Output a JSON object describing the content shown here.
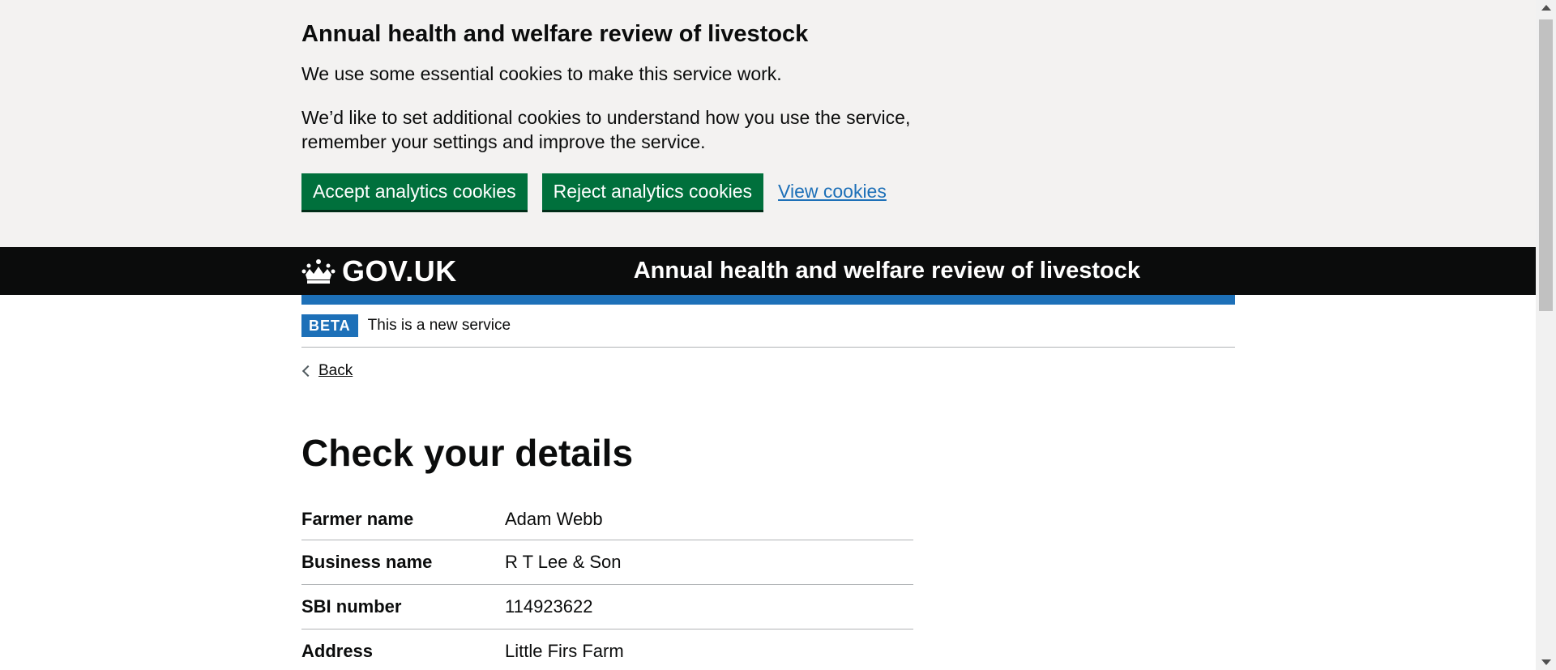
{
  "cookie_banner": {
    "heading": "Annual health and welfare review of livestock",
    "text1": "We use some essential cookies to make this service work.",
    "text2": "We’d like to set additional cookies to understand how you use the service, remember your settings and improve the service.",
    "accept_label": "Accept analytics cookies",
    "reject_label": "Reject analytics cookies",
    "view_label": "View cookies"
  },
  "header": {
    "logo_text": "GOV.UK",
    "logo_icon": "crown-icon",
    "service_name": "Annual health and welfare review of livestock"
  },
  "phase_banner": {
    "tag": "BETA",
    "text": "This is a new service"
  },
  "back_link": "Back",
  "page_title": "Check your details",
  "details": [
    {
      "key": "Farmer name",
      "value": "Adam Webb"
    },
    {
      "key": "Business name",
      "value": "R T Lee & Son"
    },
    {
      "key": "SBI number",
      "value": "114923622"
    },
    {
      "key": "Address",
      "value": "Little Firs Farm"
    }
  ],
  "colors": {
    "button_green": "#00703c",
    "link_blue": "#1d70b8",
    "header_black": "#0b0c0c",
    "banner_grey": "#f3f2f1"
  }
}
